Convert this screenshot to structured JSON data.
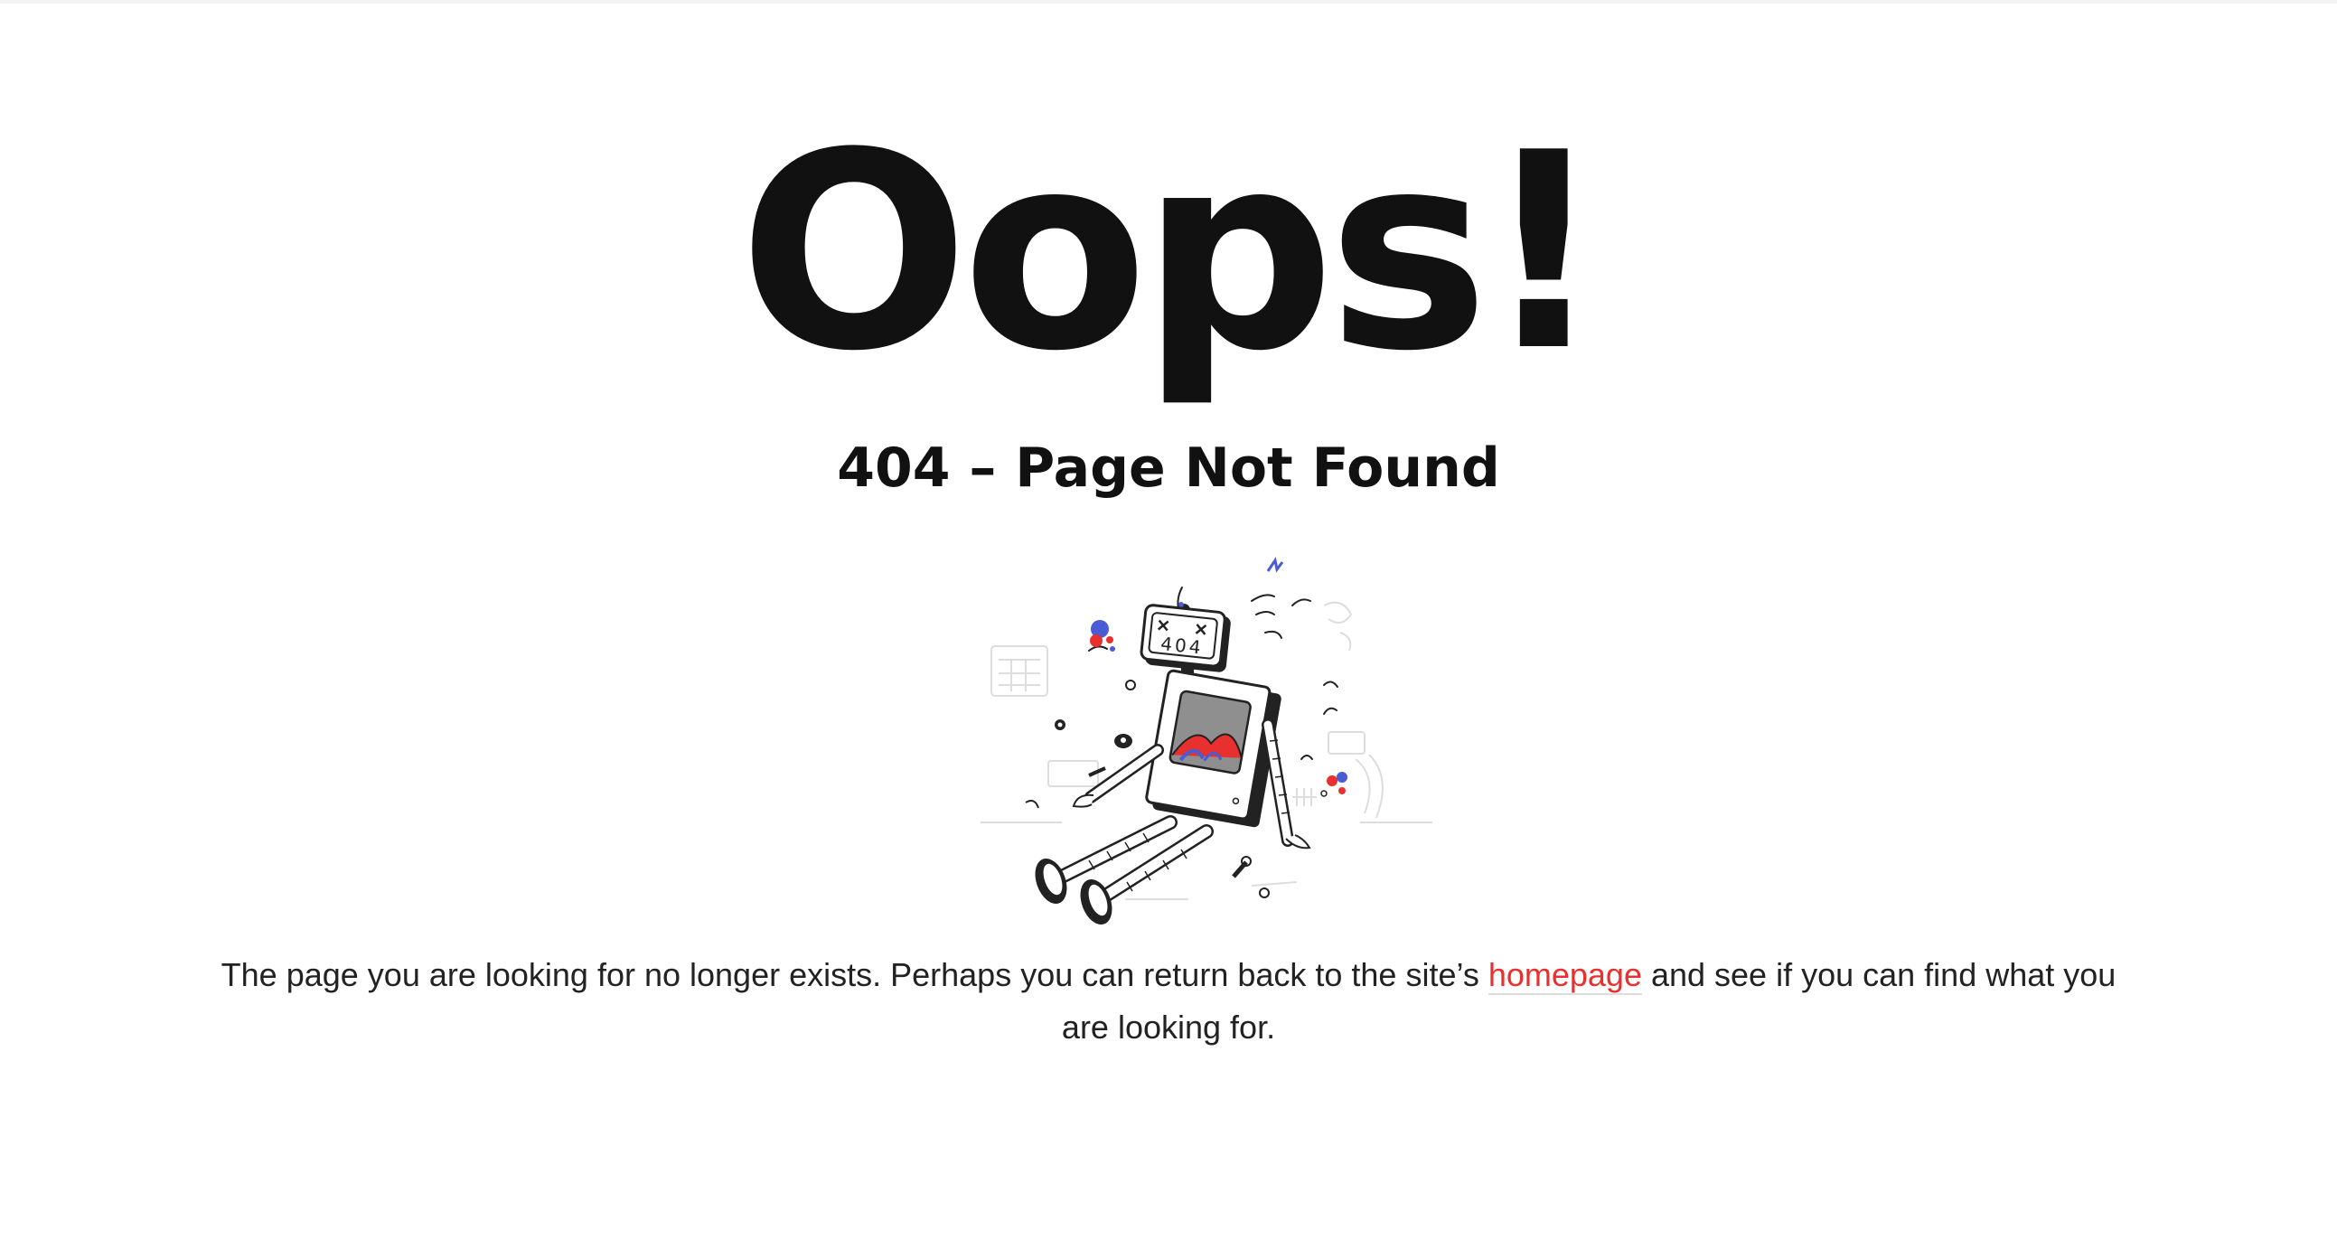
{
  "headline": "Oops!",
  "subheading": "404 – Page Not Found",
  "illustration": {
    "screen_text": "404",
    "icon": "broken-robot-icon"
  },
  "message": {
    "before_link": "The page you are looking for no longer exists. Perhaps you can return back to the site’s ",
    "link_label": "homepage",
    "after_link": " and see if you can find what you are looking for."
  },
  "colors": {
    "text": "#111111",
    "link": "#e8302e",
    "accent_blue": "#4a5bd6",
    "accent_red": "#e8302e",
    "background": "#ffffff"
  }
}
